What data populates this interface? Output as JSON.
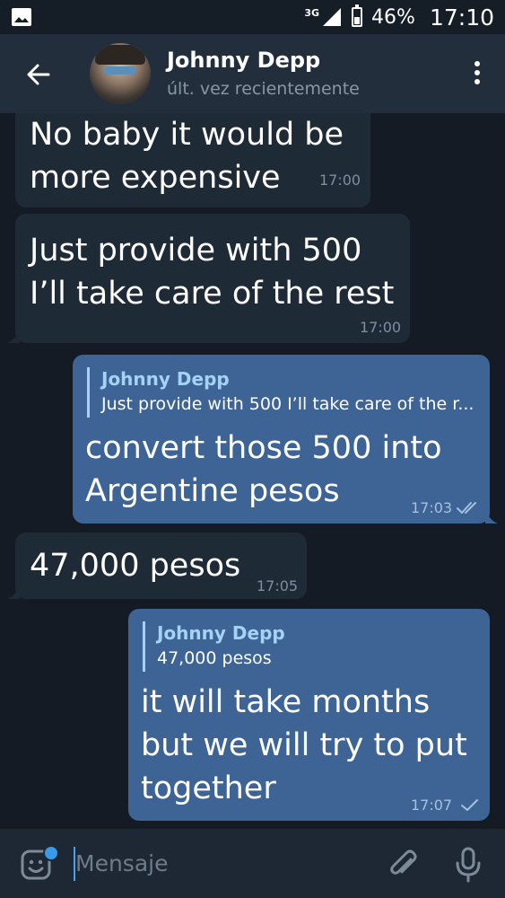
{
  "status_bar": {
    "network": "3G",
    "battery_percent": "46%",
    "battery_level": 0.46,
    "time": "17:10"
  },
  "header": {
    "contact_name": "Johnny Depp",
    "last_seen": "últ. vez recientemente"
  },
  "messages": [
    {
      "direction": "in",
      "lines": [
        "No baby it would be",
        "more expensive"
      ],
      "time": "17:00"
    },
    {
      "direction": "in",
      "lines": [
        "Just provide with 500",
        "I’ll take care of the rest"
      ],
      "time": "17:00"
    },
    {
      "direction": "out",
      "reply_to": {
        "name": "Johnny Depp",
        "text": "Just provide with 500 I’ll take care of the r..."
      },
      "lines": [
        "convert those 500 into",
        "Argentine pesos"
      ],
      "time": "17:03",
      "status": "read"
    },
    {
      "direction": "in",
      "lines": [
        "47,000 pesos"
      ],
      "time": "17:05"
    },
    {
      "direction": "out",
      "reply_to": {
        "name": "Johnny Depp",
        "text": "47,000 pesos"
      },
      "lines": [
        "it will take months",
        "but we will try to put",
        "together"
      ],
      "time": "17:07",
      "status": "sent"
    }
  ],
  "input": {
    "placeholder": "Mensaje"
  },
  "colors": {
    "background": "#151b24",
    "header": "#232e3c",
    "incoming_bubble": "#1f2a37",
    "outgoing_bubble": "#3d6494",
    "reply_accent": "#a7d2f7"
  },
  "icons": [
    "image-icon",
    "signal-icon",
    "battery-icon",
    "back-arrow-icon",
    "more-vert-icon",
    "emoji-icon",
    "attach-icon",
    "mic-icon",
    "double-check-icon",
    "check-icon"
  ]
}
